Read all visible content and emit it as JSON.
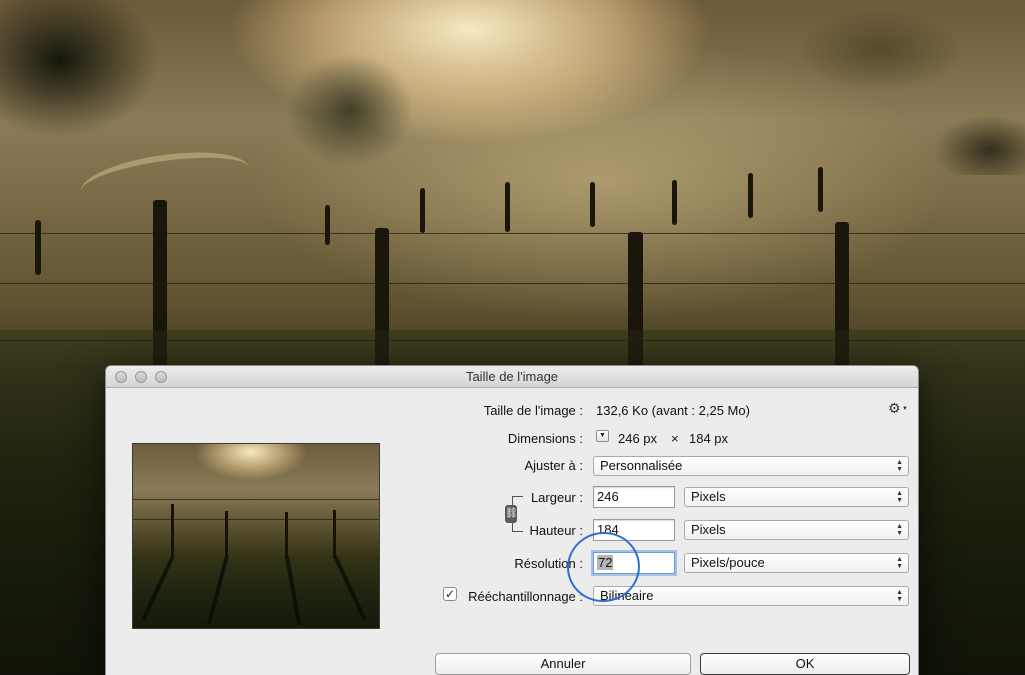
{
  "window": {
    "title": "Taille de l'image"
  },
  "info": {
    "size_label": "Taille de l'image :",
    "size_value": "132,6 Ko (avant : 2,25 Mo)",
    "dimensions_label": "Dimensions :",
    "width_px": "246 px",
    "times": "×",
    "height_px": "184 px"
  },
  "fit": {
    "label": "Ajuster à :",
    "value": "Personnalisée"
  },
  "width": {
    "label": "Largeur :",
    "value": "246",
    "unit": "Pixels"
  },
  "height": {
    "label": "Hauteur :",
    "value": "184",
    "unit": "Pixels"
  },
  "resolution": {
    "label": "Résolution :",
    "value": "72",
    "unit": "Pixels/pouce"
  },
  "resample": {
    "label": "Rééchantillonnage :",
    "checked": true,
    "value": "Bilinéaire"
  },
  "buttons": {
    "cancel": "Annuler",
    "ok": "OK"
  },
  "icons": {
    "gear": "gear-icon",
    "dimensions_popup": "triangle-down-icon",
    "chain": "chain-link-icon",
    "select_arrows": "updown-arrows-icon",
    "checkmark": "checkmark-icon"
  },
  "colors": {
    "annotation_circle": "#2f6fd1",
    "focus_ring": "#6d9bd8"
  }
}
